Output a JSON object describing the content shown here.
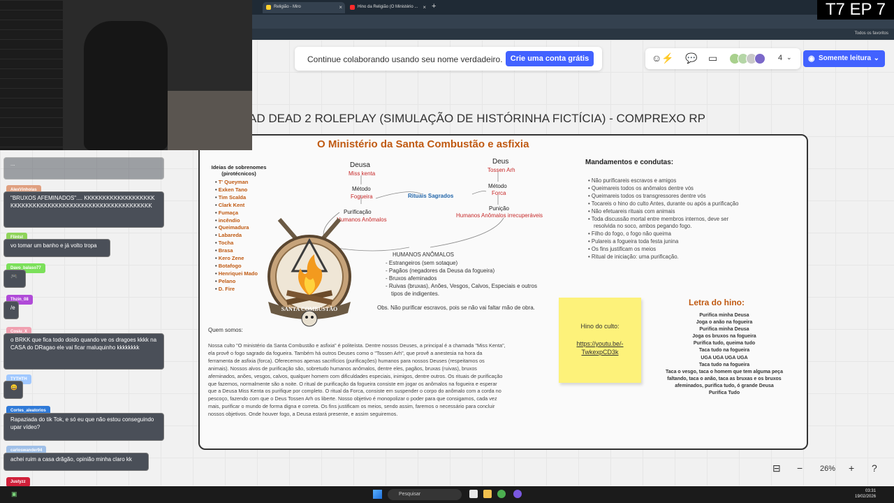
{
  "browser": {
    "tabs": [
      {
        "label": "Religião - Miro",
        "active": true
      },
      {
        "label": "Hino da Religião (O Ministério ..."
      }
    ],
    "bookmarks_label": "Todos os favoritos"
  },
  "banner": {
    "text": "Continue colaborando usando seu nome verdadeiro.",
    "cta": "Crie uma conta grátis"
  },
  "toolbar": {
    "participants_count": "4",
    "readonly_label": "Somente leitura"
  },
  "board": {
    "title": "AD DEAD 2 ROLEPLAY (SIMULAÇÃO DE HISTÓRINHA FICTÍCIA) - COMPREXO RP",
    "frame_title": "O Ministério da Santa Combustão e asfixia",
    "surnames_heading": "Ideias de sobrenomes (pirotécnicos)",
    "surnames": [
      "T' Queyman",
      "Exken Tano",
      "Tim Scalda",
      "Clark Kent",
      "Fumaça",
      "incêndio",
      "Queimadura",
      "Labareda",
      "Tocha",
      "Brasa",
      "Kero Zene",
      "Botafogo",
      "Henriquei Mado",
      "Pelano",
      "D. Fire"
    ],
    "diagram": {
      "deusa": "Deusa",
      "deusa_name": "Miss kenta",
      "metodo_l": "Método",
      "metodo_l_val": "Fogueira",
      "purificacao": "Purificação",
      "humanos_anomalos": "Humanos Anômalos",
      "deus": "Deus",
      "deus_name": "Tossen Arh",
      "metodo_r": "Método",
      "metodo_r_val": "Forca",
      "punicao": "Punição",
      "humanos_irrecuperaveis": "Humanos Anômalos irrecuperáveis",
      "rituais": "Rituais Sagrados"
    },
    "humans_heading": "HUMANOS ANÔMALOS",
    "humans": [
      "- Estrangeiros (sem sotaque)",
      "- Pagãos (negadores da Deusa da fogueira)",
      "- Bruxos afeminados",
      "- Ruivas (bruxas), Anões, Vesgos, Calvos, Especiais e outros",
      "  tipos de indigentes."
    ],
    "obs": "Obs. Não purificar escravos, pois se não vai faltar mão de obra.",
    "emblem_text": "SANTA COMBUSTÃO",
    "about_heading": "Quem somos:",
    "about_text": "Nossa culto \"O ministério da Santa Combustão e asfixia\" é politeísta. Dentre nossos Deuses, a principal é a chamada \"Miss Kenta\", ela provê o fogo sagrado da fogueira. Também há outros Deuses como o \"Tossen Arh\", que provê a anestesia na hora da ferramenta de asfixia (forca). Oferecemos apenas sacrifícios (purificações) humanos para nossos Deuses (respeitamos os animais). Nossos alvos de purificação são, sobretudo humanos anômalos, dentre eles, pagãos, bruxas (ruivas), bruxos afeminados, anões, vesgos, calvos, qualquer homem com dificuldades especiais, inimigos, dentre outros. Os rituais de purificação que fazemos, normalmente são a noite. O ritual de purificação da fogueira consiste em jogar os anômalos na fogueira e esperar que a Deusa Miss Kenta os purifique por completo. O ritual da Forca, consiste em suspender o corpo do anômalo com a corda no pescoço, fazendo com que o Deus Tossen Arh os liberte. Nosso objetivo é monopolizar o poder para que consigamos, cada vez mais, purificar o mundo de forma digna e correta. Os fins justificam os meios, sendo assim, faremos o necessário para concluir nossos objetivos. Onde houver fogo, a Deusa estará presente, e assim seguiremos.",
    "rules_heading": "Mandamentos e condutas:",
    "rules": [
      "• Não purificareis escravos e amigos",
      "• Queimareis todos os anômalos dentre vós",
      "• Queimareis todos os transgressores dentre vós",
      "• Tocareis o hino do culto Antes, durante ou após a purificação",
      "• Não efetuareis rituais com animais",
      "• Toda discussão mortal entre membros internos, deve ser",
      "  resolvida no soco, ambos pegando fogo.",
      "• Filho do fogo, o fogo não queima",
      "• Pulareis a fogueira toda festa junina",
      "• Os fins justificam os meios",
      "• Ritual de iniciação: uma purificação."
    ],
    "sticky_title": "Hino do culto:",
    "sticky_link": "https://youtu.be/-TwkexpCD3k",
    "hymn_heading": "Letra do hino:",
    "hymn": [
      "Purifica minha Deusa",
      "Joga o anão na fogueira",
      "Purifica minha Deusa",
      "Joga os bruxos na fogueira",
      "Purifica tudo, queima tudo",
      "Taca tudo na fogueira",
      "UGA UGA UGA UGA",
      "Taca tudo na fogueira",
      "Taca o vesgo, taca o homem que tem alguma peça",
      "faltando, taca o anão, taca as bruxas e os bruxos",
      "afeminados, purifica tudo, ó grande Deusa",
      "Purifica Tudo"
    ]
  },
  "zoom": {
    "level": "26%"
  },
  "overlay": {
    "episode": "T7 EP 7"
  },
  "chat": [
    {
      "user": "",
      "text": "...",
      "color": "#555555"
    },
    {
      "user": "AlexVinholas",
      "text": "\"BRUXOS AFEMINADOS\".... KKKKKKKKKKKKKKKKKKKKKKKKKKKKKKKKKKKKKKKKKKKKKKKKKKKKKKKKK",
      "color": "#e0a080"
    },
    {
      "user": "Flintst",
      "text": "vo tomar um banho e já volto tropa",
      "color": "#8fd45a"
    },
    {
      "user": "Davo_balaso77",
      "text": "🎮",
      "color": "#7be05a"
    },
    {
      "user": "Thzin_08",
      "text": "/e",
      "color": "#b04ad8"
    },
    {
      "user": "Cosiu_X",
      "text": "o BRKK que fica todo doido quando ve os dragoes kkkk na CASA do DRagao ele vai ficar maluquinho kkkkkkkk",
      "color": "#f0a0b0"
    },
    {
      "user": "TYTHTH",
      "text": "😀",
      "color": "#a0c8ff"
    },
    {
      "user": "Cortes_aleatorios",
      "text": "Rapaziada do tik Tok, e só eu que não estou conseguindo upar vídeo?",
      "color": "#2f7ad8"
    },
    {
      "user": "carloswander94",
      "text": "achei ruim a casa drãgão, opinião minha claro kk",
      "color": "#a0c0e8"
    },
    {
      "user": "Justyzz",
      "text": "",
      "color": "#d0203a"
    }
  ],
  "taskbar": {
    "search_placeholder": "Pesquisar",
    "time": "03:31",
    "date": "19/02/2026"
  },
  "colors": {
    "miro_blue": "#4262ff",
    "accent_orange": "#c05a12",
    "red": "#c62828",
    "sticky": "#fdf27a"
  }
}
